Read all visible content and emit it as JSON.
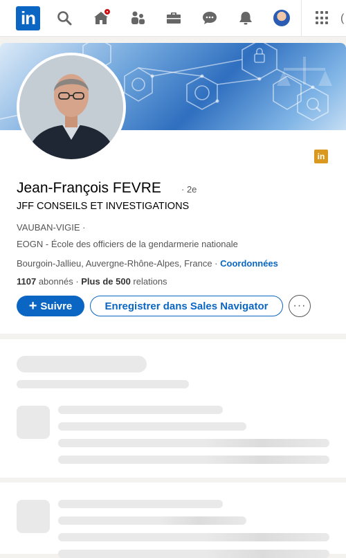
{
  "nav": {
    "logo": "in",
    "icons": [
      "search-icon",
      "home-icon",
      "network-icon",
      "jobs-icon",
      "messaging-icon",
      "notifications-icon",
      "me-avatar",
      "apps-grid-icon"
    ]
  },
  "colors": {
    "accent": "#0a66c2",
    "notification": "#cc1016",
    "company_logo": "#d9981f"
  },
  "profile": {
    "company_logo_text": "in",
    "name": "Jean-François FEVRE",
    "degree": "· 2e",
    "headline": "JFF CONSEILS ET INVESTIGATIONS",
    "company": "VAUBAN-VIGIE ·",
    "school": "EOGN - École des officiers de la gendarmerie nationale",
    "location": "Bourgoin-Jallieu, Auvergne-Rhône-Alpes, France · ",
    "contact_link": "Coordonnées",
    "followers_count": "1107",
    "followers_label": " abonnés",
    "separator": " · ",
    "relations_count": "Plus de 500",
    "relations_label": " relations"
  },
  "actions": {
    "follow_icon": "+",
    "follow": "Suivre",
    "sales_navigator": "Enregistrer dans Sales Navigator",
    "more": "···"
  }
}
